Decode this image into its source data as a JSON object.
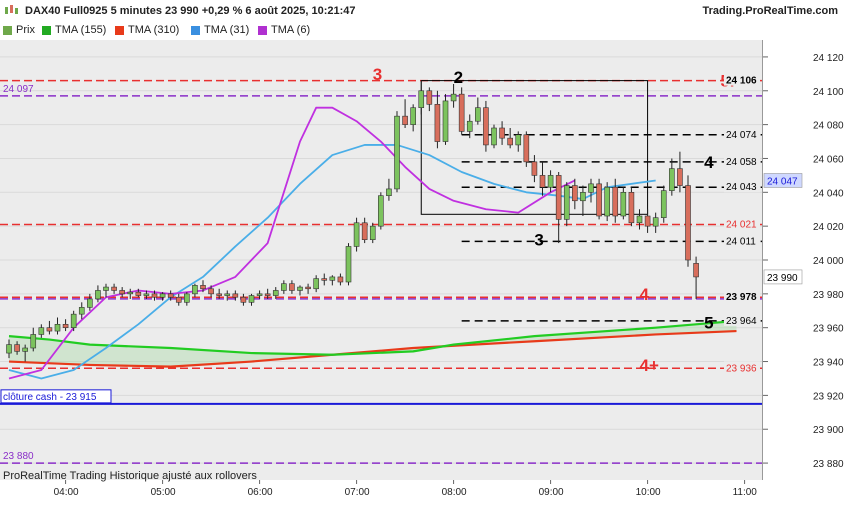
{
  "header": {
    "title": "DAX40 Full0925 5 minutes 23 990 +0,29 % 6 août 2025, 10:21:47",
    "brand": "Trading.ProRealTime.com"
  },
  "legend": [
    {
      "label": "Prix",
      "color": "#6fa84a"
    },
    {
      "label": "TMA (155)",
      "color": "#22aa22"
    },
    {
      "label": "TMA (310)",
      "color": "#e83a1a"
    },
    {
      "label": "TMA (31)",
      "color": "#3a8fe0"
    },
    {
      "label": "TMA (6)",
      "color": "#b030d0"
    }
  ],
  "footer": "ProRealTime Trading  Historique ajusté aux rollovers",
  "colors": {
    "up": "#7cc35e",
    "down": "#d86e5c",
    "plot_bg": "#ececec",
    "red_level": "#e83030",
    "purple_level": "#8a2ec8",
    "blue_level": "#1a1ad8",
    "tma155": "#22cc22",
    "tma310": "#e83a1a",
    "tma31": "#4aaee8",
    "tma6": "#c030e0"
  },
  "chart_data": {
    "type": "candlestick",
    "ylim": [
      23870,
      24130
    ],
    "y_ticks": [
      {
        "value": 24120,
        "label": "24 120"
      },
      {
        "value": 24100,
        "label": "24 100"
      },
      {
        "value": 24080,
        "label": "24 080"
      },
      {
        "value": 24060,
        "label": "24 060"
      },
      {
        "value": 24040,
        "label": "24 040"
      },
      {
        "value": 24020,
        "label": "24 020"
      },
      {
        "value": 24000,
        "label": "24 000"
      },
      {
        "value": 23980,
        "label": "23 980"
      },
      {
        "value": 23960,
        "label": "23 960"
      },
      {
        "value": 23940,
        "label": "23 940"
      },
      {
        "value": 23920,
        "label": "23 920"
      },
      {
        "value": 23900,
        "label": "23 900"
      },
      {
        "value": 23880,
        "label": "23 880"
      }
    ],
    "x_ticks": [
      "04:00",
      "05:00",
      "06:00",
      "07:00",
      "08:00",
      "09:00",
      "10:00",
      "11:00"
    ],
    "x_start": "03:25",
    "candles": [
      {
        "t": "03:25",
        "o": 23945,
        "h": 23953,
        "l": 23942,
        "c": 23950
      },
      {
        "t": "03:30",
        "o": 23950,
        "h": 23952,
        "l": 23944,
        "c": 23946
      },
      {
        "t": "03:35",
        "o": 23946,
        "h": 23950,
        "l": 23940,
        "c": 23948
      },
      {
        "t": "03:40",
        "o": 23948,
        "h": 23960,
        "l": 23946,
        "c": 23956
      },
      {
        "t": "03:45",
        "o": 23956,
        "h": 23962,
        "l": 23954,
        "c": 23960
      },
      {
        "t": "03:50",
        "o": 23960,
        "h": 23964,
        "l": 23956,
        "c": 23958
      },
      {
        "t": "03:55",
        "o": 23958,
        "h": 23966,
        "l": 23956,
        "c": 23962
      },
      {
        "t": "04:00",
        "o": 23962,
        "h": 23965,
        "l": 23958,
        "c": 23960
      },
      {
        "t": "04:05",
        "o": 23960,
        "h": 23970,
        "l": 23958,
        "c": 23968
      },
      {
        "t": "04:10",
        "o": 23968,
        "h": 23975,
        "l": 23965,
        "c": 23972
      },
      {
        "t": "04:15",
        "o": 23972,
        "h": 23980,
        "l": 23970,
        "c": 23977
      },
      {
        "t": "04:20",
        "o": 23977,
        "h": 23985,
        "l": 23975,
        "c": 23982
      },
      {
        "t": "04:25",
        "o": 23982,
        "h": 23986,
        "l": 23978,
        "c": 23984
      },
      {
        "t": "04:30",
        "o": 23984,
        "h": 23986,
        "l": 23980,
        "c": 23982
      },
      {
        "t": "04:35",
        "o": 23982,
        "h": 23984,
        "l": 23978,
        "c": 23980
      },
      {
        "t": "04:40",
        "o": 23980,
        "h": 23983,
        "l": 23977,
        "c": 23981
      },
      {
        "t": "04:45",
        "o": 23981,
        "h": 23983,
        "l": 23978,
        "c": 23979
      },
      {
        "t": "04:50",
        "o": 23979,
        "h": 23982,
        "l": 23977,
        "c": 23980
      },
      {
        "t": "04:55",
        "o": 23980,
        "h": 23982,
        "l": 23976,
        "c": 23978
      },
      {
        "t": "05:00",
        "o": 23978,
        "h": 23981,
        "l": 23976,
        "c": 23980
      },
      {
        "t": "05:05",
        "o": 23980,
        "h": 23982,
        "l": 23976,
        "c": 23978
      },
      {
        "t": "05:10",
        "o": 23978,
        "h": 23980,
        "l": 23973,
        "c": 23975
      },
      {
        "t": "05:15",
        "o": 23975,
        "h": 23981,
        "l": 23973,
        "c": 23980
      },
      {
        "t": "05:20",
        "o": 23980,
        "h": 23986,
        "l": 23978,
        "c": 23985
      },
      {
        "t": "05:25",
        "o": 23985,
        "h": 23988,
        "l": 23981,
        "c": 23983
      },
      {
        "t": "05:30",
        "o": 23983,
        "h": 23985,
        "l": 23978,
        "c": 23980
      },
      {
        "t": "05:35",
        "o": 23980,
        "h": 23983,
        "l": 23977,
        "c": 23979
      },
      {
        "t": "05:40",
        "o": 23979,
        "h": 23982,
        "l": 23976,
        "c": 23980
      },
      {
        "t": "05:45",
        "o": 23980,
        "h": 23982,
        "l": 23976,
        "c": 23978
      },
      {
        "t": "05:50",
        "o": 23978,
        "h": 23980,
        "l": 23973,
        "c": 23975
      },
      {
        "t": "05:55",
        "o": 23975,
        "h": 23980,
        "l": 23973,
        "c": 23979
      },
      {
        "t": "06:00",
        "o": 23979,
        "h": 23982,
        "l": 23977,
        "c": 23980
      },
      {
        "t": "06:05",
        "o": 23980,
        "h": 23983,
        "l": 23977,
        "c": 23979
      },
      {
        "t": "06:10",
        "o": 23979,
        "h": 23984,
        "l": 23977,
        "c": 23982
      },
      {
        "t": "06:15",
        "o": 23982,
        "h": 23988,
        "l": 23980,
        "c": 23986
      },
      {
        "t": "06:20",
        "o": 23986,
        "h": 23988,
        "l": 23980,
        "c": 23982
      },
      {
        "t": "06:25",
        "o": 23982,
        "h": 23985,
        "l": 23979,
        "c": 23984
      },
      {
        "t": "06:30",
        "o": 23984,
        "h": 23986,
        "l": 23980,
        "c": 23983
      },
      {
        "t": "06:35",
        "o": 23983,
        "h": 23991,
        "l": 23981,
        "c": 23989
      },
      {
        "t": "06:40",
        "o": 23989,
        "h": 23992,
        "l": 23985,
        "c": 23988
      },
      {
        "t": "06:45",
        "o": 23988,
        "h": 23991,
        "l": 23985,
        "c": 23990
      },
      {
        "t": "06:50",
        "o": 23990,
        "h": 23992,
        "l": 23985,
        "c": 23987
      },
      {
        "t": "06:55",
        "o": 23987,
        "h": 24010,
        "l": 23985,
        "c": 24008
      },
      {
        "t": "07:00",
        "o": 24008,
        "h": 24025,
        "l": 24005,
        "c": 24022
      },
      {
        "t": "07:05",
        "o": 24022,
        "h": 24025,
        "l": 24010,
        "c": 24012
      },
      {
        "t": "07:10",
        "o": 24012,
        "h": 24022,
        "l": 24010,
        "c": 24020
      },
      {
        "t": "07:15",
        "o": 24020,
        "h": 24040,
        "l": 24018,
        "c": 24038
      },
      {
        "t": "07:20",
        "o": 24038,
        "h": 24048,
        "l": 24035,
        "c": 24042
      },
      {
        "t": "07:25",
        "o": 24042,
        "h": 24088,
        "l": 24040,
        "c": 24085
      },
      {
        "t": "07:30",
        "o": 24085,
        "h": 24095,
        "l": 24078,
        "c": 24080
      },
      {
        "t": "07:35",
        "o": 24080,
        "h": 24092,
        "l": 24076,
        "c": 24090
      },
      {
        "t": "07:40",
        "o": 24090,
        "h": 24106,
        "l": 24086,
        "c": 24100
      },
      {
        "t": "07:45",
        "o": 24100,
        "h": 24102,
        "l": 24088,
        "c": 24092
      },
      {
        "t": "07:50",
        "o": 24092,
        "h": 24100,
        "l": 24066,
        "c": 24070
      },
      {
        "t": "07:55",
        "o": 24070,
        "h": 24098,
        "l": 24068,
        "c": 24094
      },
      {
        "t": "08:00",
        "o": 24094,
        "h": 24104,
        "l": 24090,
        "c": 24098
      },
      {
        "t": "08:05",
        "o": 24098,
        "h": 24102,
        "l": 24074,
        "c": 24076
      },
      {
        "t": "08:10",
        "o": 24076,
        "h": 24086,
        "l": 24072,
        "c": 24082
      },
      {
        "t": "08:15",
        "o": 24082,
        "h": 24096,
        "l": 24080,
        "c": 24090
      },
      {
        "t": "08:20",
        "o": 24090,
        "h": 24094,
        "l": 24064,
        "c": 24068
      },
      {
        "t": "08:25",
        "o": 24068,
        "h": 24080,
        "l": 24066,
        "c": 24078
      },
      {
        "t": "08:30",
        "o": 24078,
        "h": 24082,
        "l": 24068,
        "c": 24072
      },
      {
        "t": "08:35",
        "o": 24072,
        "h": 24078,
        "l": 24066,
        "c": 24068
      },
      {
        "t": "08:40",
        "o": 24068,
        "h": 24076,
        "l": 24064,
        "c": 24074
      },
      {
        "t": "08:45",
        "o": 24074,
        "h": 24076,
        "l": 24055,
        "c": 24058
      },
      {
        "t": "08:50",
        "o": 24058,
        "h": 24062,
        "l": 24046,
        "c": 24050
      },
      {
        "t": "08:55",
        "o": 24050,
        "h": 24058,
        "l": 24038,
        "c": 24043
      },
      {
        "t": "09:00",
        "o": 24043,
        "h": 24053,
        "l": 24040,
        "c": 24050
      },
      {
        "t": "09:05",
        "o": 24050,
        "h": 24052,
        "l": 24010,
        "c": 24024
      },
      {
        "t": "09:10",
        "o": 24024,
        "h": 24046,
        "l": 24020,
        "c": 24044
      },
      {
        "t": "09:15",
        "o": 24044,
        "h": 24048,
        "l": 24030,
        "c": 24035
      },
      {
        "t": "09:20",
        "o": 24035,
        "h": 24044,
        "l": 24026,
        "c": 24040
      },
      {
        "t": "09:25",
        "o": 24040,
        "h": 24048,
        "l": 24034,
        "c": 24045
      },
      {
        "t": "09:30",
        "o": 24045,
        "h": 24048,
        "l": 24024,
        "c": 24026
      },
      {
        "t": "09:35",
        "o": 24026,
        "h": 24046,
        "l": 24023,
        "c": 24043
      },
      {
        "t": "09:40",
        "o": 24043,
        "h": 24048,
        "l": 24022,
        "c": 24026
      },
      {
        "t": "09:45",
        "o": 24026,
        "h": 24043,
        "l": 24024,
        "c": 24040
      },
      {
        "t": "09:50",
        "o": 24040,
        "h": 24043,
        "l": 24020,
        "c": 24022
      },
      {
        "t": "09:55",
        "o": 24022,
        "h": 24030,
        "l": 24018,
        "c": 24026
      },
      {
        "t": "10:00",
        "o": 24026,
        "h": 24030,
        "l": 24016,
        "c": 24020
      },
      {
        "t": "10:05",
        "o": 24020,
        "h": 24028,
        "l": 24016,
        "c": 24025
      },
      {
        "t": "10:10",
        "o": 24025,
        "h": 24044,
        "l": 24022,
        "c": 24041
      },
      {
        "t": "10:15",
        "o": 24041,
        "h": 24060,
        "l": 24038,
        "c": 24054
      },
      {
        "t": "10:20",
        "o": 24054,
        "h": 24064,
        "l": 24040,
        "c": 24044
      },
      {
        "t": "10:25",
        "o": 24044,
        "h": 24050,
        "l": 23996,
        "c": 24000
      },
      {
        "t": "10:30",
        "o": 23998,
        "h": 24002,
        "l": 23977,
        "c": 23990
      }
    ],
    "levels": [
      {
        "value": 24106,
        "color": "red",
        "style": "dash",
        "label": "24 106",
        "label_color": "#000"
      },
      {
        "value": 24097,
        "color": "purple",
        "style": "dash",
        "label": "",
        "left_label": "24 097"
      },
      {
        "value": 24074,
        "color": "black",
        "style": "dash-short",
        "label": "24 074",
        "start": "08:05"
      },
      {
        "value": 24058,
        "color": "black",
        "style": "dash-short",
        "label": "24 058",
        "start": "08:05"
      },
      {
        "value": 24043,
        "color": "black",
        "style": "dash-short",
        "label": "24 043",
        "start": "08:05"
      },
      {
        "value": 24021,
        "color": "red",
        "style": "dash",
        "label": "24 021",
        "label_color": "#e83030"
      },
      {
        "value": 24011,
        "color": "black",
        "style": "dash-short",
        "label": "24 011",
        "start": "08:05"
      },
      {
        "value": 23978,
        "color": "red",
        "style": "dash",
        "label": "23 978",
        "label_color": "#000"
      },
      {
        "value": 23977,
        "color": "purple",
        "style": "dash",
        "label": ""
      },
      {
        "value": 23964,
        "color": "black",
        "style": "dash-short",
        "label": "23 964",
        "start": "08:05"
      },
      {
        "value": 23936,
        "color": "red",
        "style": "dash",
        "label": "23 936",
        "label_color": "#e83030"
      },
      {
        "value": 23915,
        "color": "blue",
        "style": "solid",
        "label": "",
        "left_label": "clôture cash -  23 915"
      },
      {
        "value": 23880,
        "color": "purple",
        "style": "dash",
        "label": "",
        "left_label": "23 880"
      }
    ],
    "box": {
      "x1": "07:40",
      "x2": "10:00",
      "y1": 24106,
      "y2": 24027
    },
    "annotations": [
      {
        "text": "3",
        "x": "07:10",
        "y": 24110,
        "color": "#e83030"
      },
      {
        "text": "2",
        "x": "08:00",
        "y": 24108,
        "color": "#000"
      },
      {
        "text": "5r",
        "x": "10:45",
        "y": 24106,
        "color": "#e83030"
      },
      {
        "text": "4",
        "x": "10:35",
        "y": 24058,
        "color": "#000"
      },
      {
        "text": "3",
        "x": "08:50",
        "y": 24012,
        "color": "#000"
      },
      {
        "text": "4",
        "x": "09:55",
        "y": 23980,
        "color": "#e83030"
      },
      {
        "text": "5",
        "x": "10:35",
        "y": 23963,
        "color": "#000"
      },
      {
        "text": "4+",
        "x": "09:55",
        "y": 23938,
        "color": "#e83030"
      }
    ],
    "price_tags": [
      {
        "value": 24047,
        "label": "24 047",
        "bg": "#cfd8ff",
        "fg": "#1a1ad8"
      },
      {
        "value": 23990,
        "label": "23 990",
        "bg": "#ffffff",
        "fg": "#000"
      }
    ],
    "tma155": [
      [
        0,
        23955
      ],
      [
        10,
        23953
      ],
      [
        20,
        23950
      ],
      [
        40,
        23948
      ],
      [
        60,
        23945
      ],
      [
        80,
        23944
      ],
      [
        100,
        23946
      ],
      [
        110,
        23950
      ],
      [
        130,
        23955
      ],
      [
        160,
        23960
      ],
      [
        180,
        23964
      ]
    ],
    "tma310": [
      [
        0,
        23940
      ],
      [
        20,
        23938
      ],
      [
        40,
        23937
      ],
      [
        60,
        23940
      ],
      [
        80,
        23944
      ],
      [
        100,
        23948
      ],
      [
        130,
        23952
      ],
      [
        160,
        23956
      ],
      [
        180,
        23958
      ]
    ],
    "tma31": [
      [
        0,
        23935
      ],
      [
        8,
        23930
      ],
      [
        16,
        23935
      ],
      [
        24,
        23948
      ],
      [
        32,
        23962
      ],
      [
        40,
        23978
      ],
      [
        48,
        23990
      ],
      [
        56,
        24008
      ],
      [
        64,
        24025
      ],
      [
        72,
        24045
      ],
      [
        80,
        24062
      ],
      [
        88,
        24068
      ],
      [
        96,
        24068
      ],
      [
        104,
        24062
      ],
      [
        112,
        24052
      ],
      [
        120,
        24045
      ],
      [
        128,
        24040
      ],
      [
        136,
        24038
      ],
      [
        142,
        24036
      ],
      [
        148,
        24043
      ],
      [
        160,
        24047
      ]
    ],
    "tma6": [
      [
        0,
        23930
      ],
      [
        8,
        23935
      ],
      [
        16,
        23960
      ],
      [
        24,
        23978
      ],
      [
        32,
        23982
      ],
      [
        40,
        23980
      ],
      [
        48,
        23982
      ],
      [
        56,
        23990
      ],
      [
        64,
        24010
      ],
      [
        68,
        24040
      ],
      [
        72,
        24070
      ],
      [
        76,
        24090
      ],
      [
        80,
        24090
      ],
      [
        86,
        24082
      ],
      [
        92,
        24070
      ],
      [
        98,
        24055
      ],
      [
        104,
        24042
      ],
      [
        110,
        24035
      ],
      [
        118,
        24030
      ],
      [
        126,
        24028
      ],
      [
        134,
        24040
      ],
      [
        140,
        24047
      ]
    ]
  }
}
